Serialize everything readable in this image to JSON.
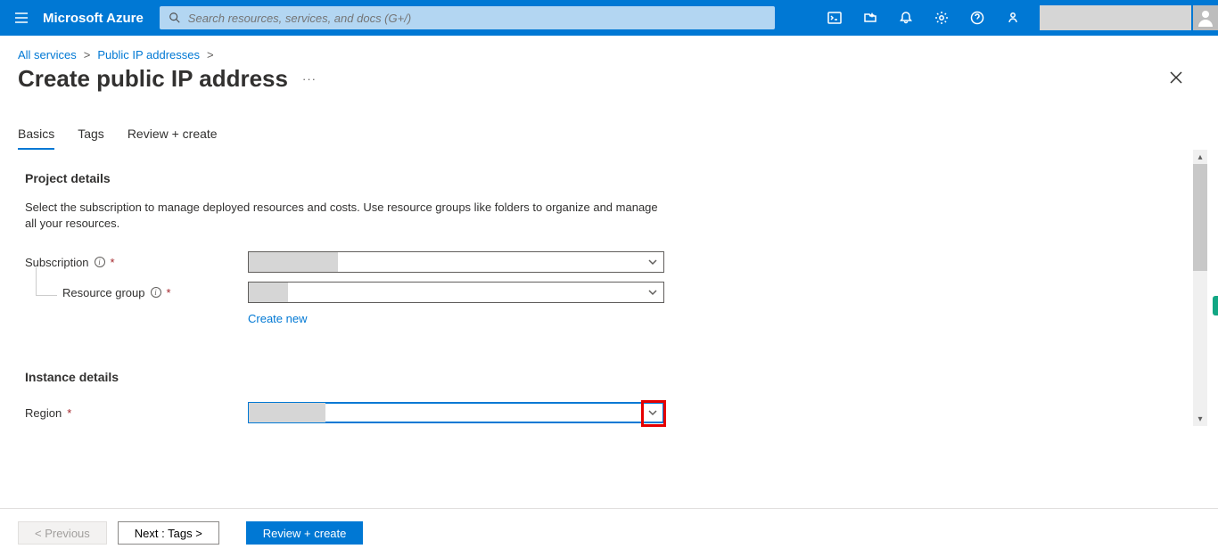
{
  "brand": "Microsoft Azure",
  "search": {
    "placeholder": "Search resources, services, and docs (G+/)"
  },
  "breadcrumb": {
    "item1": "All services",
    "item2": "Public IP addresses"
  },
  "page": {
    "title": "Create public IP address"
  },
  "tabs": {
    "t1": "Basics",
    "t2": "Tags",
    "t3": "Review + create"
  },
  "sections": {
    "project": {
      "title": "Project details",
      "desc": "Select the subscription to manage deployed resources and costs. Use resource groups like folders to organize and manage all your resources.",
      "subscriptionLabel": "Subscription",
      "resourceGroupLabel": "Resource group",
      "createNew": "Create new"
    },
    "instance": {
      "title": "Instance details",
      "regionLabel": "Region"
    }
  },
  "footer": {
    "prev": "< Previous",
    "next": "Next : Tags >",
    "review": "Review + create"
  }
}
